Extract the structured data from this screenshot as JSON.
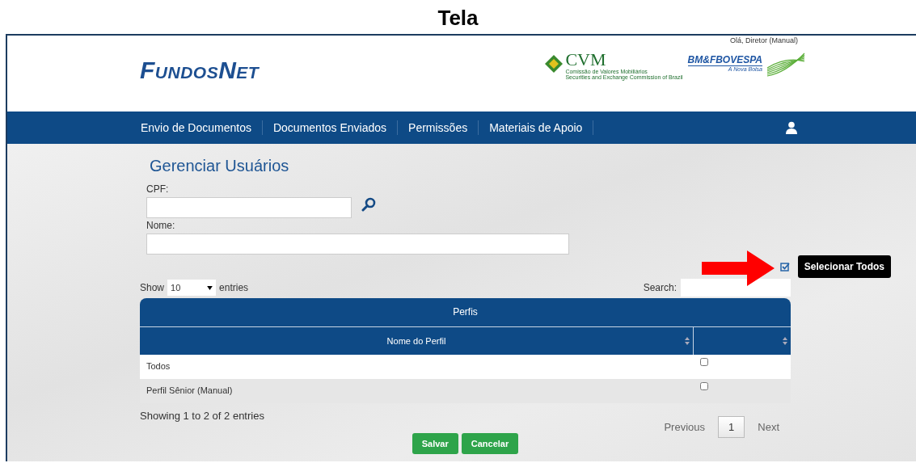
{
  "caption": "Tela",
  "header": {
    "logo": "FundosNet",
    "greeting": "Olá, Diretor (Manual)",
    "cvm": {
      "name": "CVM",
      "line1": "Comissão de Valores Mobiliários",
      "line2": "Securities and Exchange Commission of Brazil"
    },
    "bovespa": {
      "name": "BM&FBOVESPA",
      "tagline": "A Nova Bolsa"
    }
  },
  "nav": {
    "items": [
      {
        "label": "Envio de Documentos"
      },
      {
        "label": "Documentos Enviados"
      },
      {
        "label": "Permissões"
      },
      {
        "label": "Materiais de Apoio"
      }
    ]
  },
  "page": {
    "title": "Gerenciar Usuários",
    "fields": [
      {
        "label": "CPF:",
        "kind": "search"
      },
      {
        "label": "Nome:",
        "kind": "text"
      }
    ],
    "select_all": {
      "tooltip": "Selecionar Todos",
      "checked": true
    },
    "length": {
      "show": "Show",
      "value": "10",
      "entries": "entries"
    },
    "search_label": "Search:",
    "table": {
      "caption": "Perfis",
      "columns": [
        "Nome do Perfil"
      ],
      "rows": [
        {
          "name": "Todos",
          "checked": false
        },
        {
          "name": "Perfil Sênior (Manual)",
          "checked": false
        }
      ]
    },
    "info": "Showing 1 to 2 of 2 entries",
    "pagination": {
      "previous": "Previous",
      "pages": [
        {
          "label": "1",
          "selected": true
        }
      ],
      "next": "Next"
    },
    "buttons": [
      "Salvar",
      "Cancelar"
    ]
  }
}
